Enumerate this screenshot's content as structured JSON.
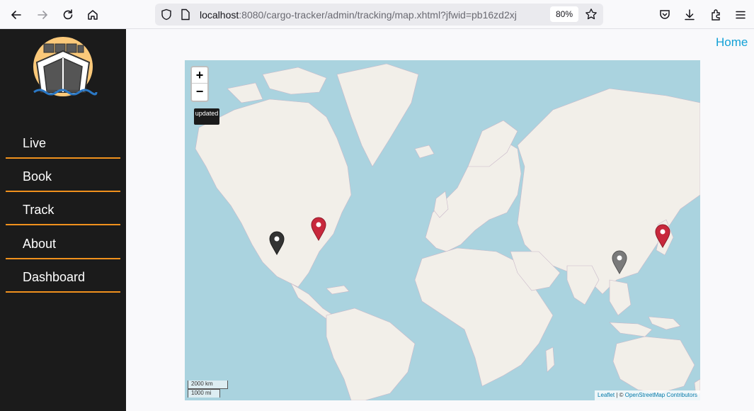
{
  "browser": {
    "url_host": "localhost",
    "url_path": ":8080/cargo-tracker/admin/tracking/map.xhtml?jfwid=pb16zd2xj",
    "zoom_level": "80%"
  },
  "sidebar": {
    "items": [
      {
        "label": "Live"
      },
      {
        "label": "Book"
      },
      {
        "label": "Track"
      },
      {
        "label": "About"
      },
      {
        "label": "Dashboard"
      }
    ],
    "accent_color": "#f0911d"
  },
  "header": {
    "home_link": "Home"
  },
  "map": {
    "zoom_in": "+",
    "zoom_out": "−",
    "status_label": "updated",
    "scale_km": "2000 km",
    "scale_mi": "1000 mi",
    "attribution_leaflet": "Leaflet",
    "attribution_separator": " | © ",
    "attribution_osm": "OpenStreetMap Contributors",
    "markers": [
      {
        "color": "#333333"
      },
      {
        "color": "#c8283c"
      },
      {
        "color": "#c8283c"
      },
      {
        "color": "#7a7a7a"
      }
    ]
  }
}
